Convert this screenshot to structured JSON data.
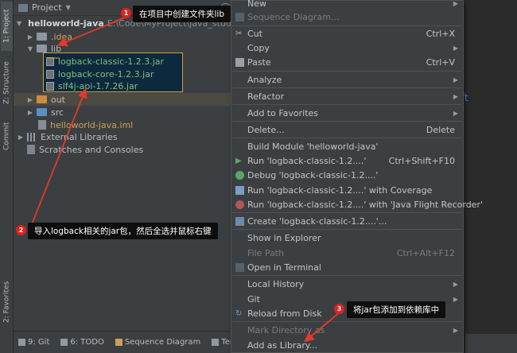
{
  "left_strip": {
    "tabs": [
      "1: Project",
      "Z: Structure",
      "Commit",
      "2: Favorites"
    ]
  },
  "project_panel": {
    "title": "Project",
    "tree": [
      {
        "name": "helloworld-java",
        "path": "E:\\Code\\MyProject\\java_study\\ja",
        "kind": "module",
        "expanded": true
      },
      {
        "name": ".idea",
        "kind": "folder-plain"
      },
      {
        "name": "lib",
        "kind": "folder-plain",
        "expanded": true
      },
      {
        "name": "logback-classic-1.2.3.jar",
        "kind": "jar"
      },
      {
        "name": "logback-core-1.2.3.jar",
        "kind": "jar"
      },
      {
        "name": "slf4j-api-1.7.26.jar",
        "kind": "jar"
      },
      {
        "name": "out",
        "kind": "folder-orange"
      },
      {
        "name": "src",
        "kind": "folder-blue"
      },
      {
        "name": "helloworld-java.iml",
        "kind": "file"
      },
      {
        "name": "External Libraries",
        "kind": "library"
      },
      {
        "name": "Scratches and Consoles",
        "kind": "scratch"
      }
    ]
  },
  "bottom_bar": {
    "items": [
      "9: Git",
      "6: TODO",
      "Sequence Diagram",
      "Termi"
    ]
  },
  "editor": {
    "visible_fragment": "ft"
  },
  "context_menu": {
    "items": [
      {
        "label": "New",
        "submenu": true
      },
      {
        "label": "Sequence Diagram...",
        "disabled": true
      },
      {
        "label": "Cut",
        "shortcut": "Ctrl+X"
      },
      {
        "label": "Copy",
        "submenu": true
      },
      {
        "label": "Paste",
        "shortcut": "Ctrl+V"
      },
      {
        "label": "Analyze",
        "submenu": true
      },
      {
        "label": "Refactor",
        "submenu": true
      },
      {
        "label": "Add to Favorites",
        "submenu": true
      },
      {
        "label": "Delete...",
        "shortcut": "Delete"
      },
      {
        "label": "Build Module 'helloworld-java'"
      },
      {
        "label": "Run 'logback-classic-1.2....'",
        "shortcut": "Ctrl+Shift+F10"
      },
      {
        "label": "Debug 'logback-classic-1.2....'"
      },
      {
        "label": "Run 'logback-classic-1.2....' with Coverage"
      },
      {
        "label": "Run 'logback-classic-1.2....' with 'Java Flight Recorder'"
      },
      {
        "label": "Create 'logback-classic-1.2....'..."
      },
      {
        "label": "Show in Explorer"
      },
      {
        "label": "File Path",
        "shortcut": "Ctrl+Alt+F12",
        "disabled": true
      },
      {
        "label": "Open in Terminal"
      },
      {
        "label": "Local History",
        "submenu": true
      },
      {
        "label": "Git",
        "submenu": true
      },
      {
        "label": "Reload from Disk"
      },
      {
        "label": "Mark Directory as",
        "submenu": true,
        "disabled": true
      },
      {
        "label": "Add as Library..."
      }
    ]
  },
  "annotations": [
    {
      "number": "1",
      "text": "在项目中创建文件夹lib"
    },
    {
      "number": "2",
      "text": "导入logback相关的jar包，然后全选并鼠标右键"
    },
    {
      "number": "3",
      "text": "将jar包添加到依赖库中"
    }
  ],
  "colors": {
    "annotation_badge": "#e02020",
    "annotation_arrow": "#e03a2a",
    "selection_outline": "#d4a13c",
    "menu_background": "#3c3f41",
    "jar_text": "#7ec07e"
  }
}
